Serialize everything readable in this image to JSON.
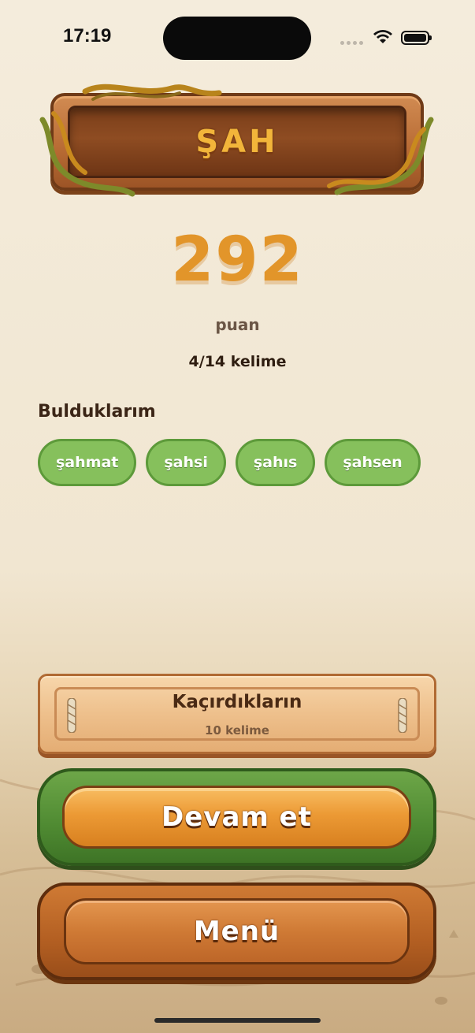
{
  "status_bar": {
    "time": "17:19"
  },
  "game": {
    "title": "ŞAH",
    "score": "292",
    "score_unit": "puan",
    "word_progress": "4/14 kelime"
  },
  "found": {
    "heading": "Bulduklarım",
    "words": [
      "şahmat",
      "şahsi",
      "şahıs",
      "şahsen"
    ]
  },
  "missed": {
    "title": "Kaçırdıkların",
    "count_label": "10 kelime"
  },
  "buttons": {
    "continue_label": "Devam et",
    "menu_label": "Menü"
  },
  "colors": {
    "score": "#e2952a",
    "chip_green": "#86c05c",
    "continue_frame": "#4f8a32",
    "wood": "#b76a33"
  }
}
